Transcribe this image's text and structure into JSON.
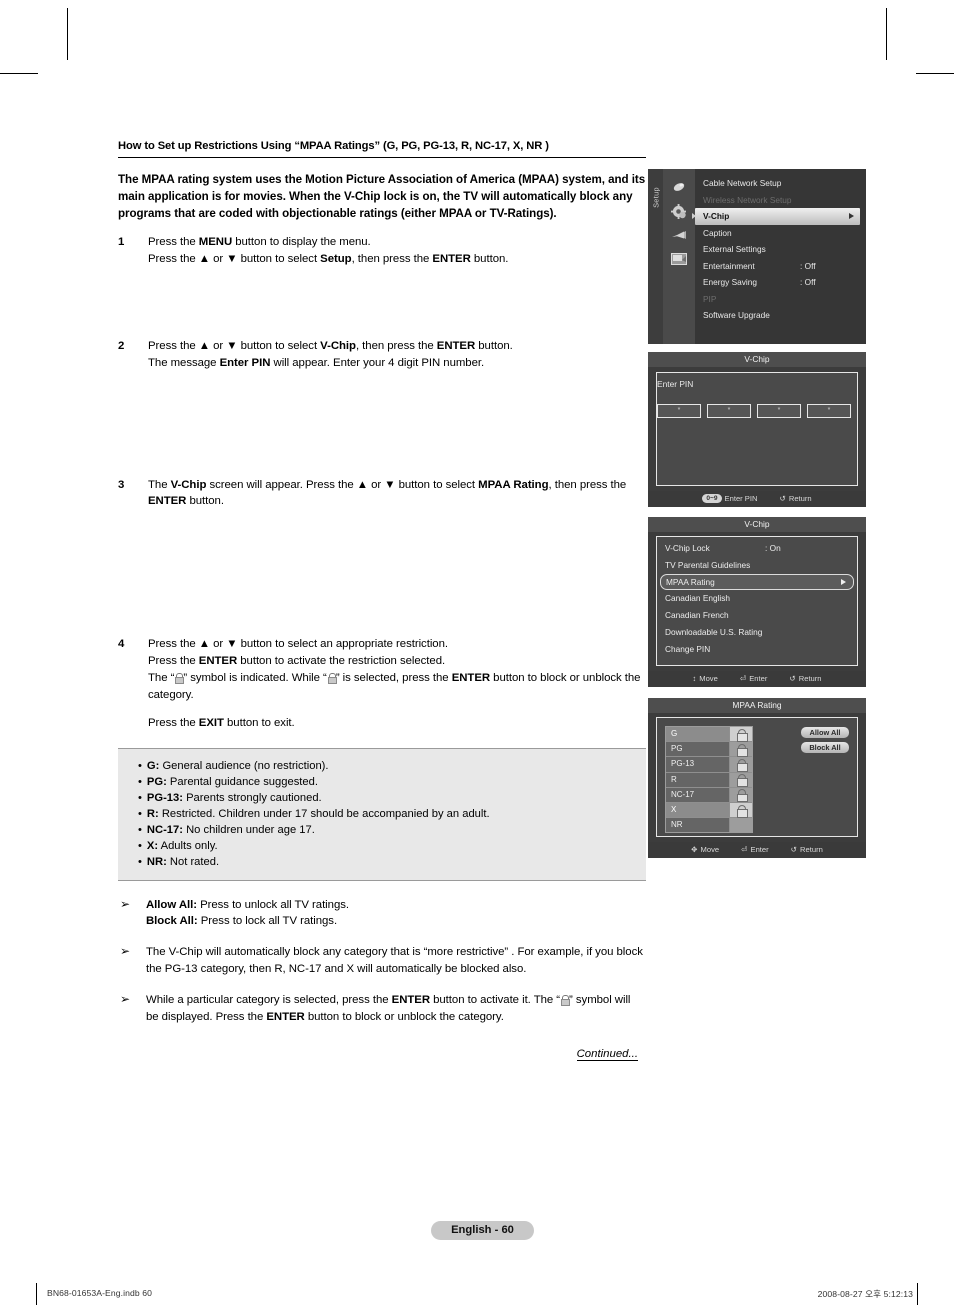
{
  "page": {
    "section_title": "How to Set up Restrictions Using “MPAA Ratings” (G, PG, PG-13, R, NC-17, X, NR )",
    "intro": "The MPAA rating system uses the Motion Picture Association of America (MPAA) system, and its main application is for movies. When the V-Chip lock is on, the TV will automatically block any programs that are coded with objectionable ratings (either MPAA or TV-Ratings).",
    "continued_label": "Continued...",
    "page_pill": "English - 60",
    "footer_left": "BN68-01653A-Eng.indb   60",
    "footer_right": "2008-08-27   오후 5:12:13"
  },
  "steps": [
    {
      "num": "1",
      "lines": [
        "Press the MENU button to display the menu.",
        "Press the ▲ or ▼ button to select Setup, then press the ENTER button."
      ]
    },
    {
      "num": "2",
      "lines": [
        "Press the ▲ or ▼ button to select V-Chip, then press the ENTER button.",
        "The message Enter PIN will appear. Enter your 4 digit PIN number."
      ]
    },
    {
      "num": "3",
      "lines": [
        "The V-Chip screen will appear. Press the ▲ or ▼ button to select MPAA Rating, then press the ENTER button."
      ]
    },
    {
      "num": "4",
      "lines": [
        "Press the ▲ or ▼ button to select an appropriate restriction.",
        "Press the ENTER button to activate the restriction selected.",
        "The “  ” symbol is indicated. While “  ” is selected, press the ENTER button to block or unblock the category.",
        "Press the EXIT button to exit."
      ]
    }
  ],
  "ratings_box": [
    {
      "code": "G:",
      "desc": "General audience (no restriction)."
    },
    {
      "code": "PG:",
      "desc": "Parental guidance suggested."
    },
    {
      "code": "PG-13:",
      "desc": "Parents strongly cautioned."
    },
    {
      "code": "R:",
      "desc": "Restricted. Children under 17 should be accompanied by an adult."
    },
    {
      "code": "NC-17:",
      "desc": "No children under age 17."
    },
    {
      "code": "X:",
      "desc": "Adults only."
    },
    {
      "code": "NR:",
      "desc": "Not rated."
    }
  ],
  "notes": {
    "note1_line1_bold": "Allow All:",
    "note1_line1_text": " Press to unlock all TV ratings.",
    "note1_line2_bold": "Block All:",
    "note1_line2_text": " Press to lock all TV ratings.",
    "note2": "The V-Chip will automatically block any category that is “more restrictive” . For example, if you block the PG-13 category, then R, NC-17 and X will automatically be blocked also.",
    "note3_a": "While a particular category is selected, press the ENTER button to activate it. The “",
    "note3_b": "” symbol will be displayed. Press the ENTER button to block or unblock the category."
  },
  "osd": {
    "setup_menu": {
      "rail_label": "Setup",
      "icons": [
        "picture-icon",
        "setup-gear-icon",
        "sound-icon",
        "input-icon"
      ],
      "items": [
        {
          "label": "Cable Network Setup",
          "value": "",
          "state": "normal"
        },
        {
          "label": "Wireless Network Setup",
          "value": "",
          "state": "disabled"
        },
        {
          "label": "V-Chip",
          "value": "",
          "state": "selected"
        },
        {
          "label": "Caption",
          "value": "",
          "state": "normal"
        },
        {
          "label": "External Settings",
          "value": "",
          "state": "normal"
        },
        {
          "label": "Entertainment",
          "value": ": Off",
          "state": "normal"
        },
        {
          "label": "Energy Saving",
          "value": ": Off",
          "state": "normal"
        },
        {
          "label": "PIP",
          "value": "",
          "state": "disabled"
        },
        {
          "label": "Software Upgrade",
          "value": "",
          "state": "normal"
        }
      ]
    },
    "pin_dialog": {
      "title": "V-Chip",
      "prompt": "Enter PIN",
      "digits": [
        "*",
        "*",
        "*",
        "*"
      ],
      "hints": [
        {
          "chip": "0~9",
          "label": "Enter PIN"
        },
        {
          "chip": "",
          "glyph": "↺",
          "label": "Return"
        }
      ]
    },
    "vchip_menu": {
      "title": "V-Chip",
      "items": [
        {
          "label": "V-Chip Lock",
          "value": ": On",
          "state": "normal"
        },
        {
          "label": "TV Parental Guidelines",
          "value": "",
          "state": "normal"
        },
        {
          "label": "MPAA Rating",
          "value": "",
          "state": "selected"
        },
        {
          "label": "Canadian English",
          "value": "",
          "state": "normal"
        },
        {
          "label": "Canadian French",
          "value": "",
          "state": "normal"
        },
        {
          "label": "Downloadable U.S. Rating",
          "value": "",
          "state": "normal"
        },
        {
          "label": "Change PIN",
          "value": "",
          "state": "normal"
        }
      ],
      "hints": [
        {
          "glyph": "↕",
          "label": "Move"
        },
        {
          "glyph": "⏎",
          "label": "Enter"
        },
        {
          "glyph": "↺",
          "label": "Return"
        }
      ]
    },
    "mpaa_screen": {
      "title": "MPAA Rating",
      "rows": [
        {
          "label": "G",
          "lock": true,
          "highlighted": true
        },
        {
          "label": "PG",
          "lock": true,
          "highlighted": false
        },
        {
          "label": "PG-13",
          "lock": true,
          "highlighted": false
        },
        {
          "label": "R",
          "lock": true,
          "highlighted": false
        },
        {
          "label": "NC-17",
          "lock": true,
          "highlighted": false
        },
        {
          "label": "X",
          "lock": true,
          "highlighted": true
        },
        {
          "label": "NR",
          "lock": false,
          "highlighted": false
        }
      ],
      "buttons": [
        "Allow All",
        "Block All"
      ],
      "hints": [
        {
          "glyph": "✥",
          "label": "Move"
        },
        {
          "glyph": "⏎",
          "label": "Enter"
        },
        {
          "glyph": "↺",
          "label": "Return"
        }
      ]
    }
  }
}
